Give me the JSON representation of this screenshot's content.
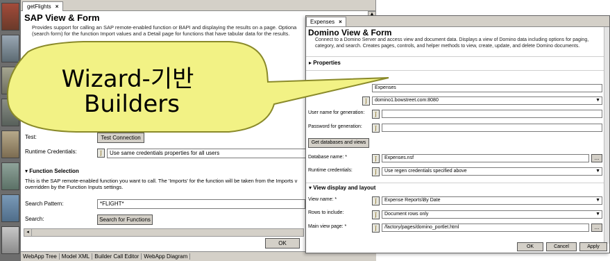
{
  "sap_window": {
    "tab_title": "getFlights",
    "tab_close": "×",
    "title": "SAP View & Form",
    "description_line1": "Provides support for calling an SAP remote-enabled function or BAPI and displaying the results on a page.  Optiona",
    "description_line2": "(search form) for the function Import values and a Detail page for functions that have tabular data for the results.",
    "test_label": "Test:",
    "test_button": "Test Connection",
    "runtime_credentials_label": "Runtime Credentials:",
    "runtime_credentials_value": "Use same credentials properties for all users",
    "function_selection_header": "Function Selection",
    "function_selection_desc_line1": "This is the SAP remote-enabled function you want to call.  The 'Imports' for the function will be taken from the Imports v",
    "function_selection_desc_line2": "overridden by the Function Inputs settings.",
    "search_pattern_label": "Search Pattern:",
    "search_pattern_value": "*FLIGHT*",
    "search_label": "Search:",
    "search_button": "Search for Functions",
    "ok_button": "OK",
    "bottom_tabs": [
      "WebApp Tree",
      "Model XML",
      "Builder Call Editor",
      "WebApp Diagram"
    ]
  },
  "domino_window": {
    "tab_title": "Expenses",
    "tab_close": "×",
    "title": "Domino View & Form",
    "description_line1": "Connect to a Domino Server and access view and document data.  Displays a view of Domino data including options for paging,",
    "description_line2": "category, and search.  Creates pages, controls, and helper methods to view, create, update, and delete Domino documents.",
    "properties_header": "Properties",
    "name_label": "Name:",
    "name_value": "Expenses",
    "server_value": "domino1.bowstreet.com:8080",
    "user_name_label": "User name for generation:",
    "password_label": "Password for generation:",
    "get_databases_button": "Get databases and views",
    "database_name_label": "Database name:  *",
    "database_name_value": "Expenses.nsf",
    "runtime_credentials_label": "Runtime credentials:",
    "runtime_credentials_value": "Use regen credentials specified above",
    "view_display_header": "View display and layout",
    "view_name_label": "View name:  *",
    "view_name_value": "Expense Reports\\By Date",
    "rows_to_include_label": "Rows to include:",
    "rows_to_include_value": "Document rows only",
    "main_view_page_label": "Main view page:  *",
    "main_view_page_value": "/factory/pages/domino_portlet.html",
    "ellipsis_button": "...",
    "ok_button": "OK",
    "cancel_button": "Cancel",
    "apply_button": "Apply"
  },
  "callout": {
    "line1": "Wizard-기반",
    "line2": "Builders",
    "fill_color": "#f2f285",
    "stroke_color": "#8a8a2a"
  }
}
